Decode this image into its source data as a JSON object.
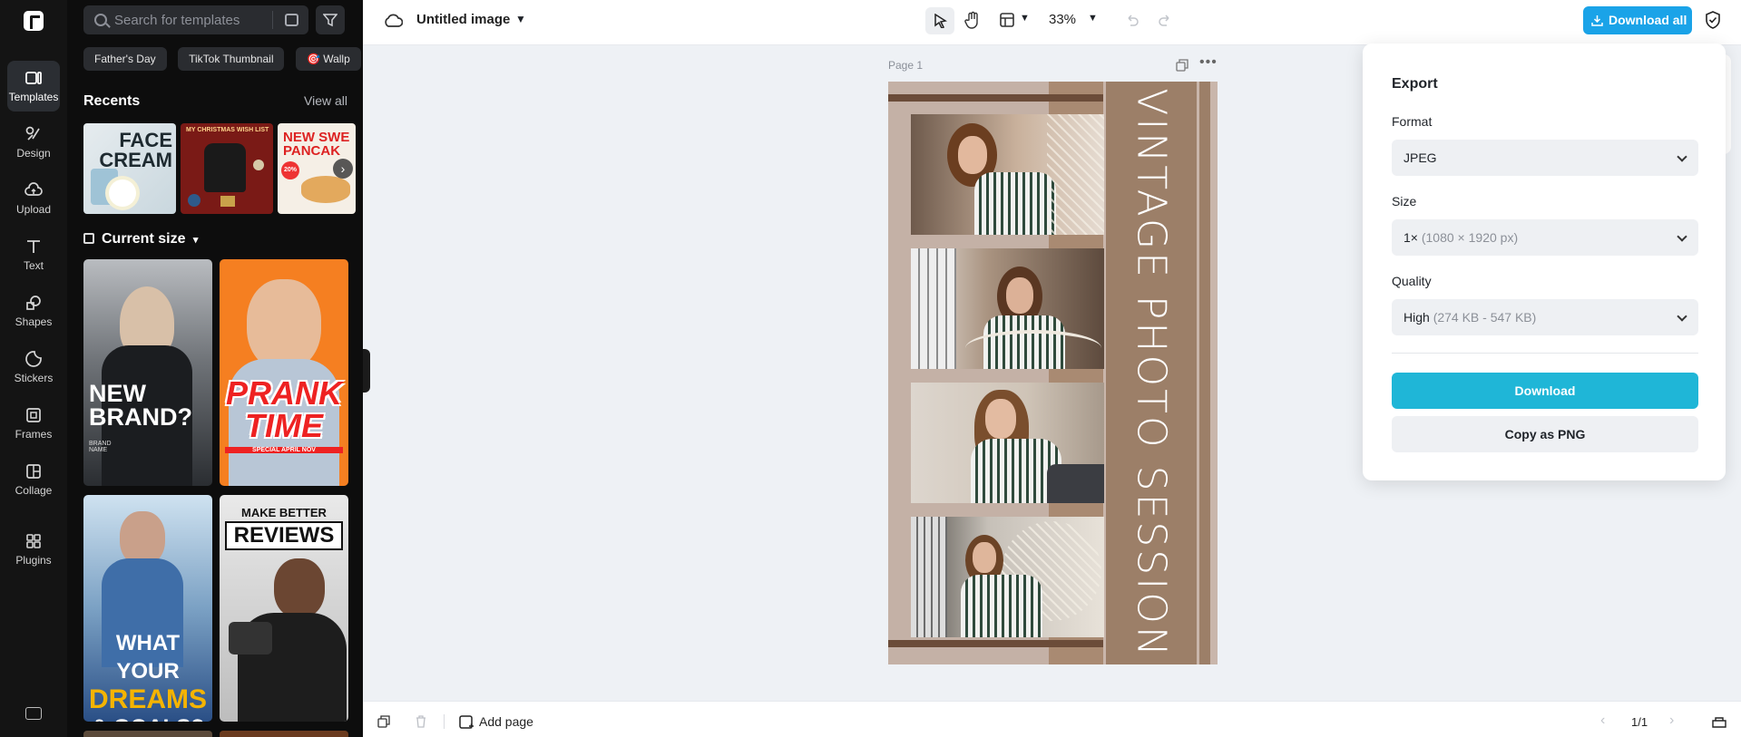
{
  "sidebar": {
    "items": [
      {
        "label": "Templates",
        "icon": "templates-icon"
      },
      {
        "label": "Design",
        "icon": "design-icon"
      },
      {
        "label": "Upload",
        "icon": "upload-icon"
      },
      {
        "label": "Text",
        "icon": "text-icon"
      },
      {
        "label": "Shapes",
        "icon": "shapes-icon"
      },
      {
        "label": "Stickers",
        "icon": "stickers-icon"
      },
      {
        "label": "Frames",
        "icon": "frames-icon"
      },
      {
        "label": "Collage",
        "icon": "collage-icon"
      },
      {
        "label": "Plugins",
        "icon": "plugins-icon"
      }
    ]
  },
  "panel": {
    "search_placeholder": "Search for templates",
    "chips": [
      "Father's Day",
      "TikTok Thumbnail",
      "🎯 Wallp"
    ],
    "recents_title": "Recents",
    "view_all": "View all",
    "recents": [
      {
        "line1": "FACE",
        "line2": "CREAM"
      },
      {
        "line1": "MY CHRISTMAS WISH LIST"
      },
      {
        "line1": "NEW SWE",
        "line2": "PANCAK",
        "badge": "20%"
      }
    ],
    "current_size": "Current size",
    "templates": [
      {
        "line1": "NEW",
        "line2": "BRAND?",
        "sub": "BRAND NAME"
      },
      {
        "line1": "PRANK",
        "line2": "TIME",
        "sub": "SPECIAL APRIL NOV"
      },
      {
        "line1": "WHAT YOUR",
        "line2": "DREAMS",
        "line3": "& GOALS?"
      },
      {
        "line1": "MAKE BETTER",
        "line2": "REVIEWS"
      }
    ]
  },
  "header": {
    "doc_title": "Untitled image",
    "zoom": "33%",
    "download_all": "Download all"
  },
  "canvas": {
    "page_label": "Page 1",
    "design_title": "VINTAGE PHOTO SESSION"
  },
  "export": {
    "title": "Export",
    "format_label": "Format",
    "format_value": "JPEG",
    "size_label": "Size",
    "size_value": "1×",
    "size_detail": "(1080 × 1920 px)",
    "quality_label": "Quality",
    "quality_value": "High",
    "quality_detail": "(274 KB - 547 KB)",
    "download": "Download",
    "copy_png": "Copy as PNG"
  },
  "footer": {
    "add_page": "Add page",
    "page_count": "1/1"
  },
  "colors": {
    "accent_download_all": "#1aa3e8",
    "accent_download": "#1fb6d7",
    "sidebar_bg": "#141414",
    "design_brown": "#9c7f68"
  }
}
